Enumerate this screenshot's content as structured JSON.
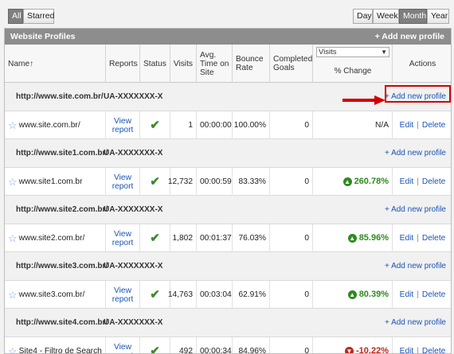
{
  "filter": {
    "all": "All",
    "starred": "Starred"
  },
  "period": {
    "day": "Day",
    "week": "Week",
    "month": "Month",
    "year": "Year",
    "selected": "Month"
  },
  "panel": {
    "title": "Website Profiles",
    "add_new_profile": "+ Add new profile"
  },
  "columns": {
    "name": "Name↑",
    "reports": "Reports",
    "status": "Status",
    "visits": "Visits",
    "avg_time": "Avg. Time on Site",
    "bounce": "Bounce Rate",
    "goals": "Completed Goals",
    "metric_select": "Visits",
    "pct_change": "% Change",
    "actions": "Actions"
  },
  "accounts": [
    {
      "url": "http://www.site.com.br/",
      "ua": "UA-XXXXXXX-X",
      "add": "+ Add new profile",
      "profile": {
        "name": "www.site.com.br/",
        "view": "View report",
        "visits": "1",
        "time": "00:00:00",
        "bounce": "100.00%",
        "goals": "0",
        "change": "N/A",
        "direction": "none",
        "edit": "Edit",
        "sep": "|",
        "delete": "Delete"
      }
    },
    {
      "url": "http://www.site1.com.br/",
      "ua": "UA-XXXXXXX-X",
      "add": "+ Add new profile",
      "profile": {
        "name": "www.site1.com.br",
        "view": "View report",
        "visits": "12,732",
        "time": "00:00:59",
        "bounce": "83.33%",
        "goals": "0",
        "change": "260.78%",
        "direction": "up",
        "edit": "Edit",
        "sep": "|",
        "delete": "Delete"
      }
    },
    {
      "url": "http://www.site2.com.br/",
      "ua": "UA-XXXXXXX-X",
      "add": "+ Add new profile",
      "profile": {
        "name": "www.site2.com.br/",
        "view": "View report",
        "visits": "1,802",
        "time": "00:01:37",
        "bounce": "76.03%",
        "goals": "0",
        "change": "85.96%",
        "direction": "up",
        "edit": "Edit",
        "sep": "|",
        "delete": "Delete"
      }
    },
    {
      "url": "http://www.site3.com.br/",
      "ua": "UA-XXXXXXX-X",
      "add": "+ Add new profile",
      "profile": {
        "name": "www.site3.com.br/",
        "view": "View report",
        "visits": "14,763",
        "time": "00:03:04",
        "bounce": "62.91%",
        "goals": "0",
        "change": "80.39%",
        "direction": "up",
        "edit": "Edit",
        "sep": "|",
        "delete": "Delete"
      }
    },
    {
      "url": "http://www.site4.com.br/",
      "ua": "UA-XXXXXXX-X",
      "add": "+ Add new profile",
      "profile": {
        "name": "Site4 - Filtro de Search",
        "view": "View report",
        "visits": "492",
        "time": "00:00:34",
        "bounce": "84.96%",
        "goals": "0",
        "change": "-10.22%",
        "direction": "down",
        "edit": "Edit",
        "sep": "|",
        "delete": "Delete"
      }
    }
  ],
  "icons": {
    "star": "star-icon",
    "check": "checkmark-icon",
    "up": "arrow-up-circle-icon",
    "down": "arrow-down-circle-icon",
    "callout": "red-arrow-icon"
  },
  "colors": {
    "link": "#1a55b5",
    "positive": "#2e8b1e",
    "negative": "#c0261b",
    "highlight": "#d40000",
    "header": "#8d8d8d"
  }
}
